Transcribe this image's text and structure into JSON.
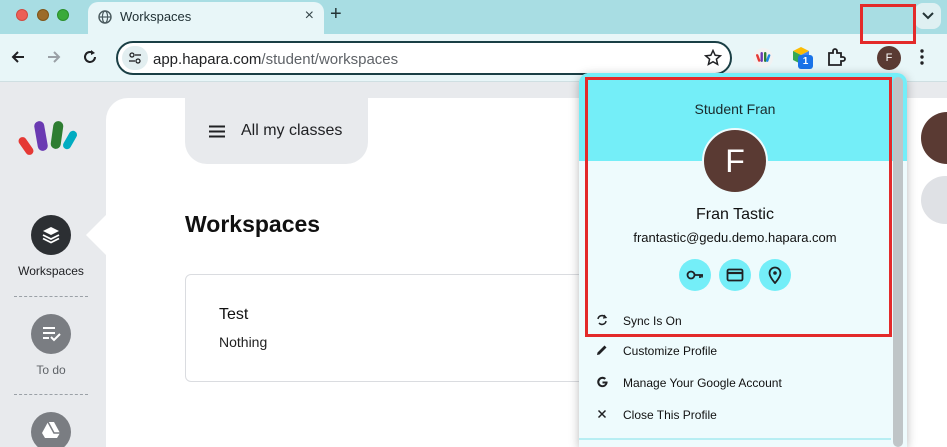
{
  "browser": {
    "tab": {
      "title": "Workspaces"
    },
    "url": {
      "domain": "app.hapara.com",
      "path": "/student/workspaces"
    },
    "extension_badge": "1",
    "profile_initial": "F"
  },
  "sidebar": {
    "items": [
      {
        "label": "Workspaces",
        "icon": "layers-icon",
        "active": true
      },
      {
        "label": "To do",
        "icon": "checklist-icon",
        "active": false
      },
      {
        "label": "",
        "icon": "drive-icon",
        "active": false
      }
    ]
  },
  "main": {
    "class_selector": "All my classes",
    "title": "Workspaces",
    "cards": [
      {
        "title": "Test",
        "subtitle": "Nothing"
      }
    ]
  },
  "profile_popup": {
    "header_name": "Student Fran",
    "avatar_initial": "F",
    "name": "Fran Tastic",
    "email": "frantastic@gedu.demo.hapara.com",
    "icon_buttons": [
      "key-icon",
      "credit-card-icon",
      "location-pin-icon"
    ],
    "menu": [
      {
        "label": "Sync Is On",
        "icon": "sync-icon"
      },
      {
        "label": "Customize Profile",
        "icon": "pencil-icon"
      },
      {
        "label": "Manage Your Google Account",
        "icon": "google-g-icon"
      },
      {
        "label": "Close This Profile",
        "icon": "close-icon"
      }
    ]
  },
  "colors": {
    "tabstrip": "#a8dde3",
    "popup_header": "#74eef8",
    "highlight_box": "#e32a2a",
    "avatar": "#5a3a33"
  }
}
